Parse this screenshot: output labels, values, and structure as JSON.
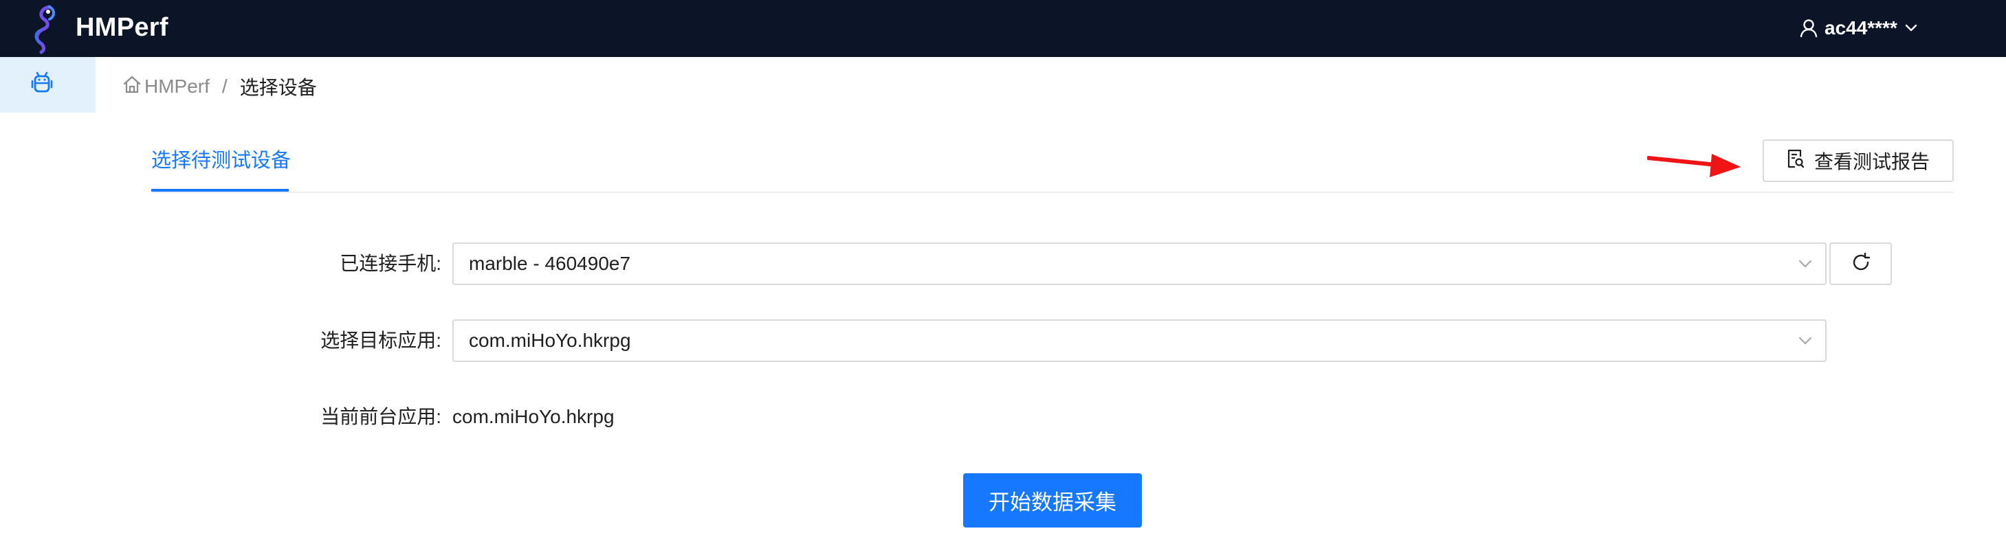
{
  "header": {
    "app_title": "HMPerf",
    "user": {
      "name": "ac44****",
      "icon": "user-icon",
      "dropdown_icon": "chevron-down-icon"
    },
    "logo_icon": "seahorse-logo"
  },
  "sidebar": {
    "items": [
      {
        "icon": "android-icon",
        "active": true
      }
    ]
  },
  "breadcrumb": {
    "home_icon": "home-icon",
    "home_label": "HMPerf",
    "separator": "/",
    "current": "选择设备"
  },
  "tabs": [
    {
      "label": "选择待测试设备",
      "active": true
    }
  ],
  "toolbar": {
    "report_label": "查看测试报告",
    "report_icon": "report-search-icon"
  },
  "form": {
    "device_label": "已连接手机:",
    "device_value": "marble - 460490e7",
    "app_label": "选择目标应用:",
    "app_value": "com.miHoYo.hkrpg",
    "foreground_label": "当前前台应用:",
    "foreground_value": "com.miHoYo.hkrpg",
    "refresh_icon": "refresh-icon",
    "start_label": "开始数据采集"
  },
  "colors": {
    "header_bg": "#0b1527",
    "accent": "#1677ff",
    "side_active_bg": "#e3f1fc",
    "annotation_arrow": "#f01414"
  }
}
